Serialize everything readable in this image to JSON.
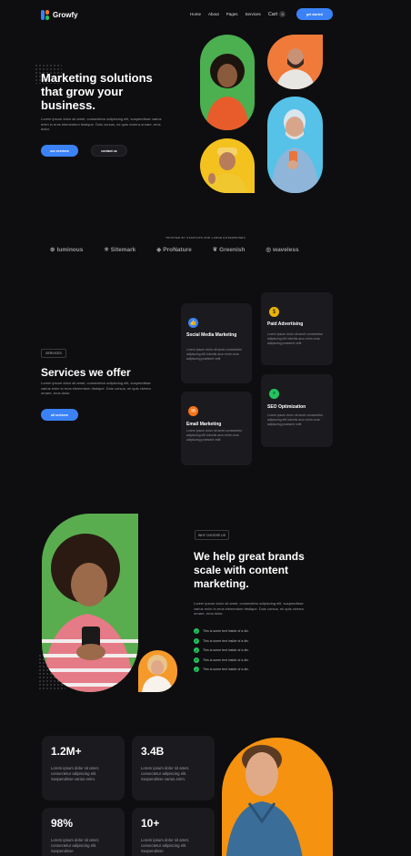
{
  "nav": {
    "brand": "Growfy",
    "links": [
      "Home",
      "About",
      "Pages",
      "Services"
    ],
    "cart_label": "Cart",
    "cart_count": "0",
    "cta": "get started"
  },
  "hero": {
    "title": "Marketing solutions that grow your business.",
    "body": "Lorem ipsum dolor sit amet, consectetur adipiscing elit, suspendisse varius enim in eros elementum tristique. Duis cursus, mi quis viverra ornare, eros dolor.",
    "primary_button": "our services",
    "secondary_button": "contact us"
  },
  "trusted": {
    "label": "TRUSTED BY STARTUPS AND LARGE ENTERPRISES",
    "brands": [
      "luminous",
      "Sitemark",
      "ProNature",
      "Greenish",
      "waveless"
    ]
  },
  "services": {
    "tag": "SERVICES",
    "title": "Services we offer",
    "body": "Lorem ipsum dolor sit amet, consectetur adipiscing elit, suspendisse varius enim in eros elementum tristique. Duis cursus, mi quis viverra ornare, eros dolor.",
    "button": "all services",
    "cards": [
      {
        "title": "Social Media Marketing",
        "body": "Lorem ipsum dolor sit amet consectetur adipiscing elit lobortis arcu enim urna adipiscing praesent velit",
        "icon": "thumbs-up-icon",
        "color": "#3b82f6"
      },
      {
        "title": "Paid Advertising",
        "body": "Lorem ipsum dolor sit amet consectetur adipiscing elit lobortis arcu enim urna adipiscing praesent velit",
        "icon": "dollar-icon",
        "color": "#eab308"
      },
      {
        "title": "Email Marketing",
        "body": "Lorem ipsum dolor sit amet consectetur adipiscing elit lobortis arcu enim urna adipiscing praesent velit",
        "icon": "mail-icon",
        "color": "#f97316"
      },
      {
        "title": "SEO Optimization",
        "body": "Lorem ipsum dolor sit amet consectetur adipiscing elit lobortis arcu enim urna adipiscing praesent velit",
        "icon": "search-icon",
        "color": "#22c55e"
      }
    ]
  },
  "why": {
    "tag": "WHY CHOOSE US",
    "title": "We help great brands scale with content marketing.",
    "body": "Lorem ipsum dolor sit amet, consectetur adipiscing elit, suspendisse varius enim in eros elementum tristique. Duis cursus, mi quis viverra ornare, eros dolor.",
    "checks": [
      "This is some text inside of a div.",
      "This is some text inside of a div.",
      "This is some text inside of a div.",
      "This is some text inside of a div.",
      "This is some text inside of a div."
    ]
  },
  "stats": [
    {
      "value": "1.2M+",
      "body": "Lorem ipsum dolor sit amet, consectetur adipiscing elit. Suspendisse varius enim."
    },
    {
      "value": "3.4B",
      "body": "Lorem ipsum dolor sit amet, consectetur adipiscing elit. Suspendisse varius enim."
    },
    {
      "value": "98%",
      "body": "Lorem ipsum dolor sit amet, consectetur adipiscing elit. Suspendisse"
    },
    {
      "value": "10+",
      "body": "Lorem ipsum dolor sit amet, consectetur adipiscing elit. Suspendisse"
    }
  ],
  "colors": {
    "accent": "#3b82f6",
    "background": "#0e0e10",
    "card": "#1b1b1f"
  }
}
